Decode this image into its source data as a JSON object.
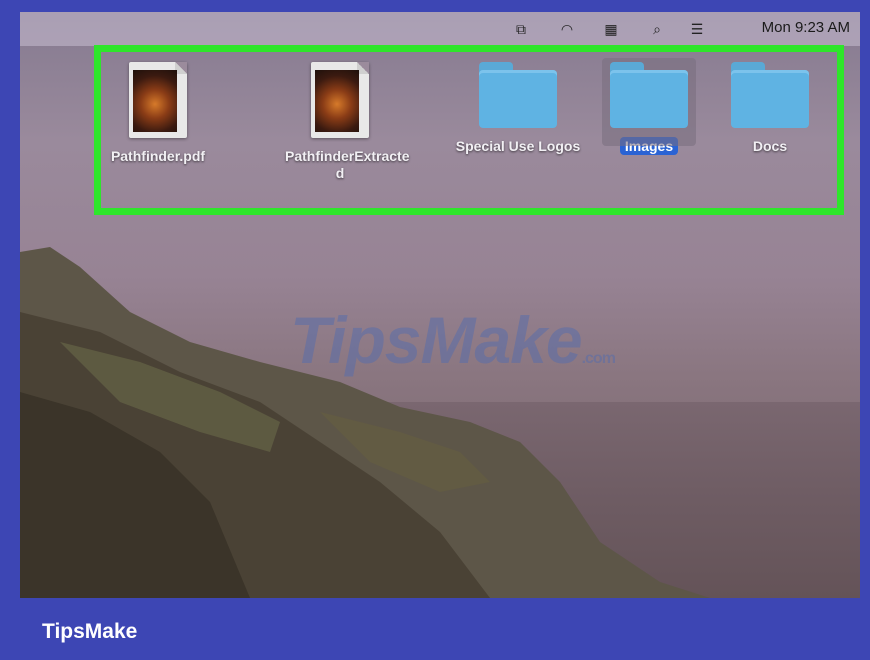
{
  "menubar": {
    "icons": [
      "window-icon",
      "wifi-icon",
      "flag-icon",
      "search-icon",
      "control-center-icon"
    ],
    "clock": "Mon 9:23 AM"
  },
  "desktop": {
    "items": [
      {
        "label": "Pathfinder.pdf",
        "type": "pdf",
        "selected": false
      },
      {
        "label": "PathfinderExtracte d",
        "type": "pdf",
        "selected": false
      },
      {
        "label": "Special Use Logos",
        "type": "folder",
        "selected": false
      },
      {
        "label": "Images",
        "type": "folder",
        "selected": true
      },
      {
        "label": "Docs",
        "type": "folder",
        "selected": false
      }
    ],
    "highlight_color": "#2ee62b",
    "folder_color": "#5fb3e3",
    "selection_color": "#2a63d4"
  },
  "watermark": {
    "main": "TipsMake",
    "suffix": ".com"
  },
  "footer": {
    "brand": "TipsMake"
  }
}
